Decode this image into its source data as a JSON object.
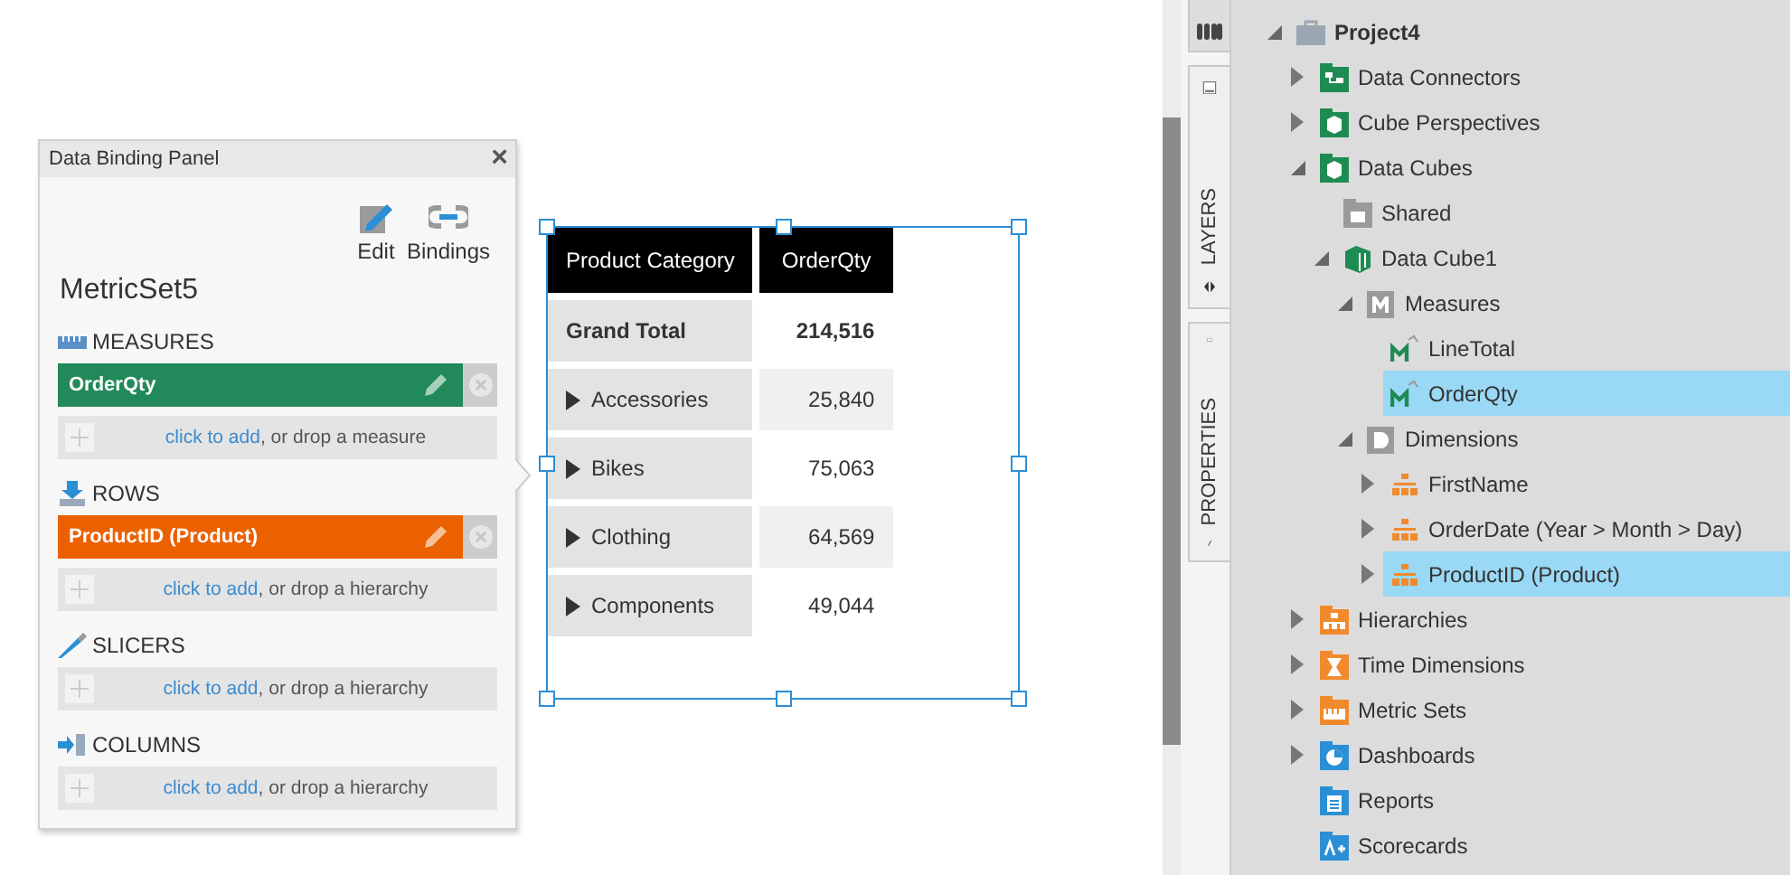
{
  "panel": {
    "title": "Data Binding Panel",
    "close": "×",
    "actions": [
      {
        "kind": "edit",
        "label": "Edit"
      },
      {
        "kind": "bindings",
        "label": "Bindings"
      }
    ],
    "metric_set": "MetricSet5",
    "sections": [
      {
        "kind": "measures",
        "title": "MEASURES",
        "items": [
          {
            "label": "OrderQty",
            "color": "#21895a"
          }
        ],
        "add_link": "click to add",
        "add_text": ", or drop a measure"
      },
      {
        "kind": "rows",
        "title": "ROWS",
        "items": [
          {
            "label": "ProductID (Product)",
            "color": "#eb6100"
          }
        ],
        "add_link": "click to add",
        "add_text": ", or drop a hierarchy"
      },
      {
        "kind": "slicers",
        "title": "SLICERS",
        "add_link": "click to add",
        "add_text": ", or drop a hierarchy"
      },
      {
        "kind": "columns",
        "title": "COLUMNS",
        "add_link": "click to add",
        "add_text": ", or drop a hierarchy"
      }
    ]
  },
  "table": {
    "columns": [
      "Product Category",
      "OrderQty"
    ],
    "rows": [
      {
        "kind": "total",
        "label": "Grand Total",
        "value": "214,516"
      },
      {
        "kind": "member",
        "label": "Accessories",
        "value": "25,840"
      },
      {
        "kind": "member",
        "label": "Bikes",
        "value": "75,063"
      },
      {
        "kind": "member",
        "label": "Clothing",
        "value": "64,569"
      },
      {
        "kind": "member",
        "label": "Components",
        "value": "49,044"
      }
    ]
  },
  "side_tabs": [
    {
      "kind": "explorer",
      "selected": true
    },
    {
      "kind": "layers",
      "label": "LAYERS",
      "selected": false
    },
    {
      "kind": "properties",
      "label": "PROPERTIES",
      "selected": false
    }
  ],
  "tree": [
    {
      "label": "Project4",
      "kind": "project",
      "expandable": true,
      "expanded": true,
      "selected": false,
      "children": [
        {
          "label": "Data Connectors",
          "kind": "connectors",
          "expandable": true,
          "expanded": false,
          "selected": false
        },
        {
          "label": "Cube Perspectives",
          "kind": "perspectives",
          "expandable": true,
          "expanded": false,
          "selected": false
        },
        {
          "label": "Data Cubes",
          "kind": "cubes",
          "expandable": true,
          "expanded": true,
          "selected": false,
          "children": [
            {
              "label": "Shared",
              "kind": "shared",
              "expandable": false,
              "selected": false
            },
            {
              "label": "Data Cube1",
              "kind": "cube",
              "expandable": true,
              "expanded": true,
              "selected": false,
              "children": [
                {
                  "label": "Measures",
                  "kind": "measures",
                  "expandable": true,
                  "expanded": true,
                  "selected": false,
                  "children": [
                    {
                      "label": "LineTotal",
                      "kind": "measure",
                      "expandable": false,
                      "selected": false
                    },
                    {
                      "label": "OrderQty",
                      "kind": "measure",
                      "expandable": false,
                      "selected": true
                    }
                  ]
                },
                {
                  "label": "Dimensions",
                  "kind": "dimensions",
                  "expandable": true,
                  "expanded": true,
                  "selected": false,
                  "children": [
                    {
                      "label": "FirstName",
                      "kind": "hierarchy",
                      "expandable": true,
                      "expanded": false,
                      "selected": false
                    },
                    {
                      "label": "OrderDate (Year > Month > Day)",
                      "kind": "hierarchy",
                      "expandable": true,
                      "expanded": false,
                      "selected": false
                    },
                    {
                      "label": "ProductID (Product)",
                      "kind": "hierarchy",
                      "expandable": true,
                      "expanded": false,
                      "selected": true
                    }
                  ]
                }
              ]
            }
          ]
        },
        {
          "label": "Hierarchies",
          "kind": "hierarchies",
          "expandable": true,
          "expanded": false,
          "selected": false
        },
        {
          "label": "Time Dimensions",
          "kind": "time",
          "expandable": true,
          "expanded": false,
          "selected": false
        },
        {
          "label": "Metric Sets",
          "kind": "metricsets",
          "expandable": true,
          "expanded": false,
          "selected": false
        },
        {
          "label": "Dashboards",
          "kind": "dashboards",
          "expandable": true,
          "expanded": false,
          "selected": false
        },
        {
          "label": "Reports",
          "kind": "reports",
          "expandable": false,
          "selected": false
        },
        {
          "label": "Scorecards",
          "kind": "scorecards",
          "expandable": false,
          "selected": false
        }
      ]
    }
  ]
}
